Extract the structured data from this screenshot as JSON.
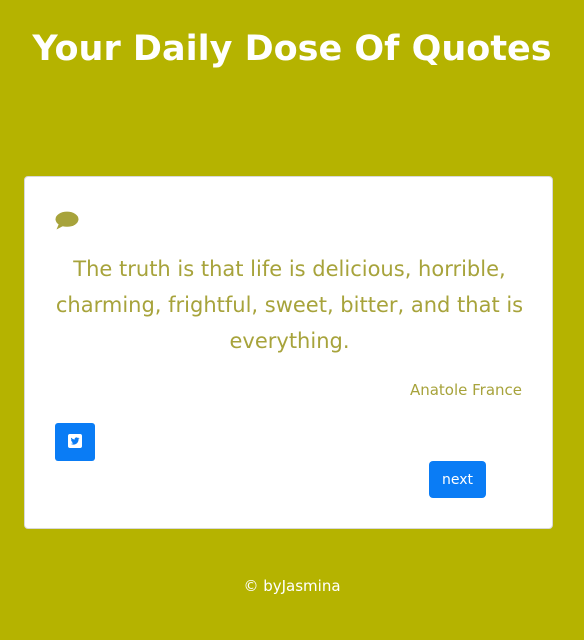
{
  "header": {
    "title": "Your Daily Dose Of Quotes"
  },
  "quote_card": {
    "icon": "speech-bubble-icon",
    "quote": "The truth is that life is delicious, horrible, charming, frightful, sweet, bitter, and that is everything.",
    "author": "Anatole France",
    "tweet_icon": "twitter-icon",
    "next_label": "next"
  },
  "footer": {
    "text": "© byJasmina"
  },
  "colors": {
    "background": "#b5b300",
    "accent_text": "#a7a33b",
    "button_blue": "#0a7cf5",
    "card_background": "#ffffff"
  }
}
